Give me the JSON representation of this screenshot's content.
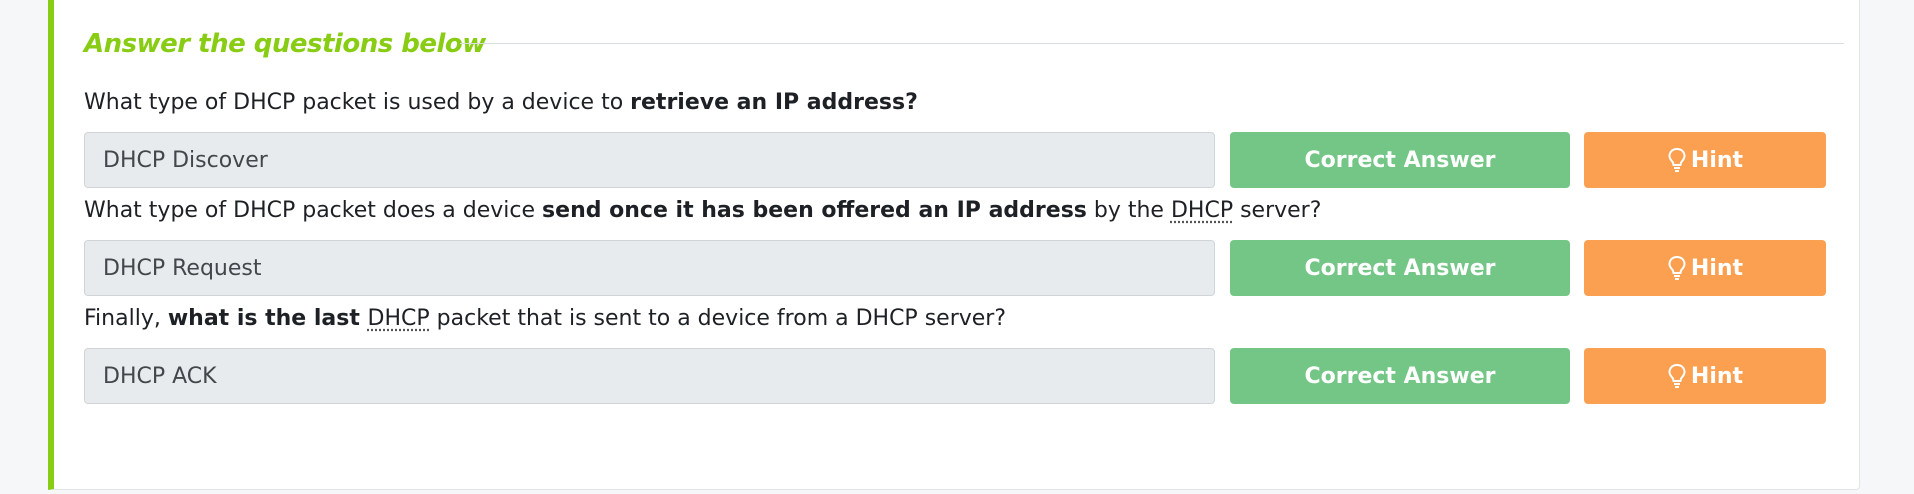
{
  "section": {
    "title": "Answer the questions below"
  },
  "questions": [
    {
      "parts": [
        {
          "text": "What type of DHCP packet is used by a device to ",
          "style": "normal"
        },
        {
          "text": "retrieve an IP address?",
          "style": "bold"
        }
      ],
      "answer": "DHCP Discover",
      "correct_label": "Correct Answer",
      "hint_label": "Hint"
    },
    {
      "parts": [
        {
          "text": "What type of DHCP packet does a device ",
          "style": "normal"
        },
        {
          "text": "send once it has been offered an IP address",
          "style": "bold"
        },
        {
          "text": " by the ",
          "style": "normal"
        },
        {
          "text": "DHCP",
          "style": "abbr"
        },
        {
          "text": " server?",
          "style": "normal"
        }
      ],
      "answer": "DHCP Request",
      "correct_label": "Correct Answer",
      "hint_label": "Hint"
    },
    {
      "parts": [
        {
          "text": "Finally, ",
          "style": "normal"
        },
        {
          "text": "what is the last ",
          "style": "bold"
        },
        {
          "text": "DHCP",
          "style": "abbr"
        },
        {
          "text": " packet that is sent to a device from a DHCP server?",
          "style": "normal"
        }
      ],
      "answer": "DHCP ACK",
      "correct_label": "Correct Answer",
      "hint_label": "Hint"
    }
  ],
  "icons": {
    "hint": "lightbulb-icon"
  },
  "colors": {
    "accent": "#88cc14",
    "correct": "#73c686",
    "hint": "#fba051",
    "input_bg": "#e8ebee"
  }
}
